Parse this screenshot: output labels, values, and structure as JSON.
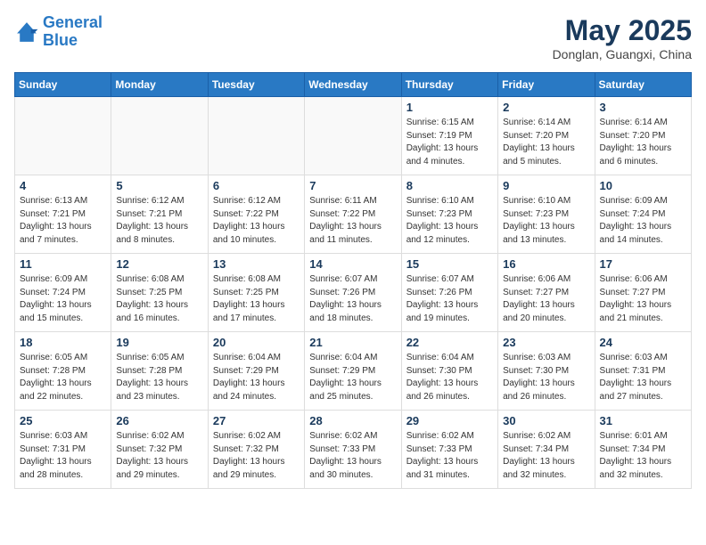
{
  "header": {
    "logo_line1": "General",
    "logo_line2": "Blue",
    "month": "May 2025",
    "location": "Donglan, Guangxi, China"
  },
  "weekdays": [
    "Sunday",
    "Monday",
    "Tuesday",
    "Wednesday",
    "Thursday",
    "Friday",
    "Saturday"
  ],
  "weeks": [
    [
      {
        "day": "",
        "info": ""
      },
      {
        "day": "",
        "info": ""
      },
      {
        "day": "",
        "info": ""
      },
      {
        "day": "",
        "info": ""
      },
      {
        "day": "1",
        "info": "Sunrise: 6:15 AM\nSunset: 7:19 PM\nDaylight: 13 hours\nand 4 minutes."
      },
      {
        "day": "2",
        "info": "Sunrise: 6:14 AM\nSunset: 7:20 PM\nDaylight: 13 hours\nand 5 minutes."
      },
      {
        "day": "3",
        "info": "Sunrise: 6:14 AM\nSunset: 7:20 PM\nDaylight: 13 hours\nand 6 minutes."
      }
    ],
    [
      {
        "day": "4",
        "info": "Sunrise: 6:13 AM\nSunset: 7:21 PM\nDaylight: 13 hours\nand 7 minutes."
      },
      {
        "day": "5",
        "info": "Sunrise: 6:12 AM\nSunset: 7:21 PM\nDaylight: 13 hours\nand 8 minutes."
      },
      {
        "day": "6",
        "info": "Sunrise: 6:12 AM\nSunset: 7:22 PM\nDaylight: 13 hours\nand 10 minutes."
      },
      {
        "day": "7",
        "info": "Sunrise: 6:11 AM\nSunset: 7:22 PM\nDaylight: 13 hours\nand 11 minutes."
      },
      {
        "day": "8",
        "info": "Sunrise: 6:10 AM\nSunset: 7:23 PM\nDaylight: 13 hours\nand 12 minutes."
      },
      {
        "day": "9",
        "info": "Sunrise: 6:10 AM\nSunset: 7:23 PM\nDaylight: 13 hours\nand 13 minutes."
      },
      {
        "day": "10",
        "info": "Sunrise: 6:09 AM\nSunset: 7:24 PM\nDaylight: 13 hours\nand 14 minutes."
      }
    ],
    [
      {
        "day": "11",
        "info": "Sunrise: 6:09 AM\nSunset: 7:24 PM\nDaylight: 13 hours\nand 15 minutes."
      },
      {
        "day": "12",
        "info": "Sunrise: 6:08 AM\nSunset: 7:25 PM\nDaylight: 13 hours\nand 16 minutes."
      },
      {
        "day": "13",
        "info": "Sunrise: 6:08 AM\nSunset: 7:25 PM\nDaylight: 13 hours\nand 17 minutes."
      },
      {
        "day": "14",
        "info": "Sunrise: 6:07 AM\nSunset: 7:26 PM\nDaylight: 13 hours\nand 18 minutes."
      },
      {
        "day": "15",
        "info": "Sunrise: 6:07 AM\nSunset: 7:26 PM\nDaylight: 13 hours\nand 19 minutes."
      },
      {
        "day": "16",
        "info": "Sunrise: 6:06 AM\nSunset: 7:27 PM\nDaylight: 13 hours\nand 20 minutes."
      },
      {
        "day": "17",
        "info": "Sunrise: 6:06 AM\nSunset: 7:27 PM\nDaylight: 13 hours\nand 21 minutes."
      }
    ],
    [
      {
        "day": "18",
        "info": "Sunrise: 6:05 AM\nSunset: 7:28 PM\nDaylight: 13 hours\nand 22 minutes."
      },
      {
        "day": "19",
        "info": "Sunrise: 6:05 AM\nSunset: 7:28 PM\nDaylight: 13 hours\nand 23 minutes."
      },
      {
        "day": "20",
        "info": "Sunrise: 6:04 AM\nSunset: 7:29 PM\nDaylight: 13 hours\nand 24 minutes."
      },
      {
        "day": "21",
        "info": "Sunrise: 6:04 AM\nSunset: 7:29 PM\nDaylight: 13 hours\nand 25 minutes."
      },
      {
        "day": "22",
        "info": "Sunrise: 6:04 AM\nSunset: 7:30 PM\nDaylight: 13 hours\nand 26 minutes."
      },
      {
        "day": "23",
        "info": "Sunrise: 6:03 AM\nSunset: 7:30 PM\nDaylight: 13 hours\nand 26 minutes."
      },
      {
        "day": "24",
        "info": "Sunrise: 6:03 AM\nSunset: 7:31 PM\nDaylight: 13 hours\nand 27 minutes."
      }
    ],
    [
      {
        "day": "25",
        "info": "Sunrise: 6:03 AM\nSunset: 7:31 PM\nDaylight: 13 hours\nand 28 minutes."
      },
      {
        "day": "26",
        "info": "Sunrise: 6:02 AM\nSunset: 7:32 PM\nDaylight: 13 hours\nand 29 minutes."
      },
      {
        "day": "27",
        "info": "Sunrise: 6:02 AM\nSunset: 7:32 PM\nDaylight: 13 hours\nand 29 minutes."
      },
      {
        "day": "28",
        "info": "Sunrise: 6:02 AM\nSunset: 7:33 PM\nDaylight: 13 hours\nand 30 minutes."
      },
      {
        "day": "29",
        "info": "Sunrise: 6:02 AM\nSunset: 7:33 PM\nDaylight: 13 hours\nand 31 minutes."
      },
      {
        "day": "30",
        "info": "Sunrise: 6:02 AM\nSunset: 7:34 PM\nDaylight: 13 hours\nand 32 minutes."
      },
      {
        "day": "31",
        "info": "Sunrise: 6:01 AM\nSunset: 7:34 PM\nDaylight: 13 hours\nand 32 minutes."
      }
    ]
  ]
}
